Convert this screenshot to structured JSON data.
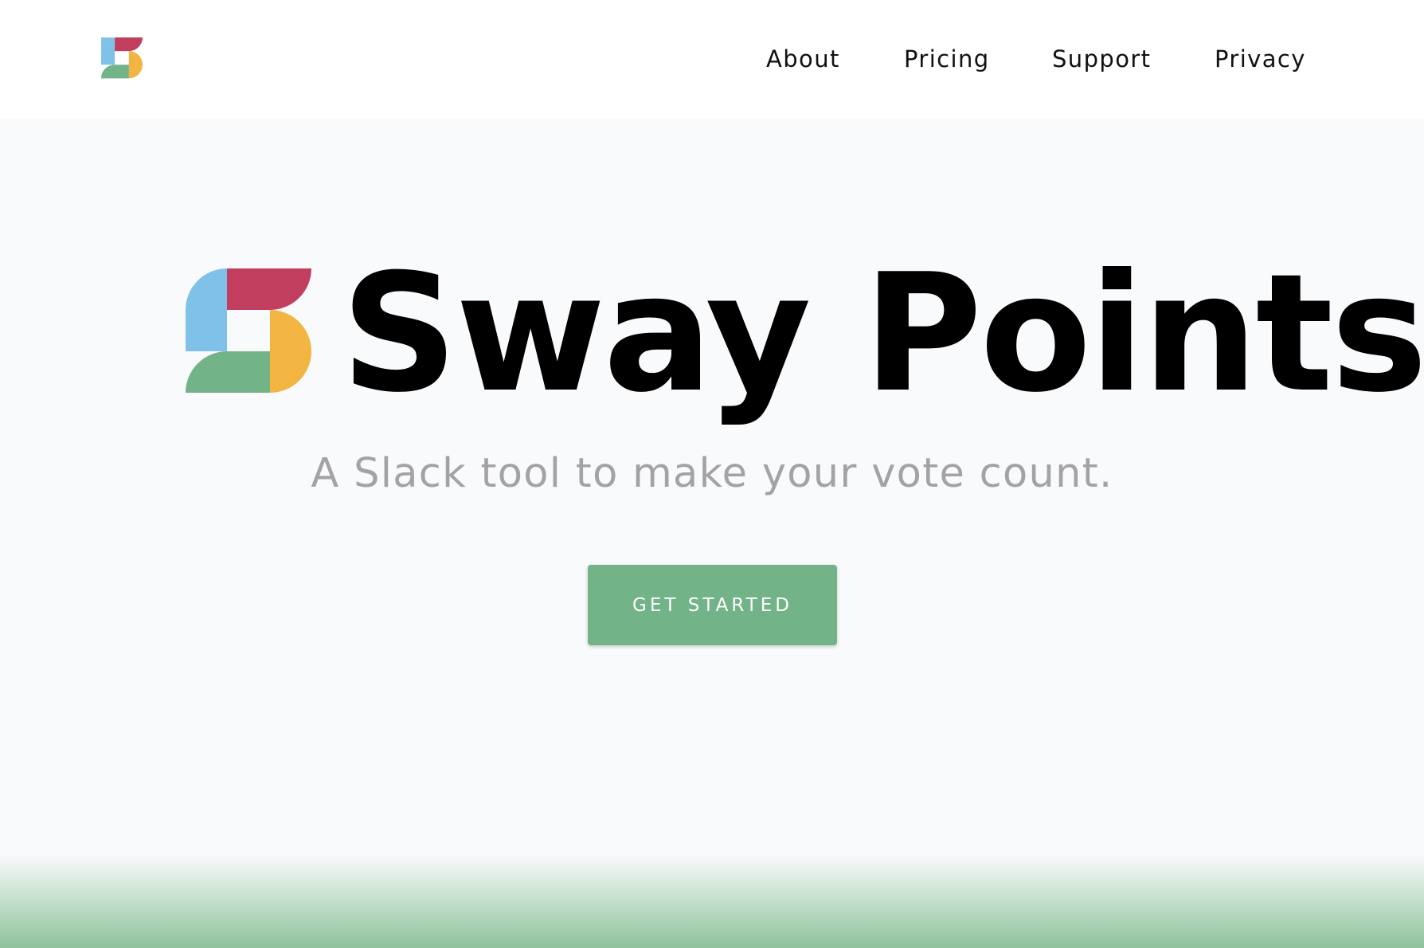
{
  "header": {
    "brand_logo": "sway-points-logo",
    "nav": [
      {
        "label": "About"
      },
      {
        "label": "Pricing"
      },
      {
        "label": "Support"
      },
      {
        "label": "Privacy"
      }
    ]
  },
  "hero": {
    "logo": "sway-points-logo",
    "title": "Sway Points",
    "subtitle": "A Slack tool to make your vote count.",
    "cta_label": "GET STARTED"
  },
  "colors": {
    "logo_blue": "#7fc1e8",
    "logo_red": "#c13e5e",
    "logo_yellow": "#f3b541",
    "logo_green": "#72b388",
    "cta_background": "#72b388",
    "page_background": "#f9fafc",
    "subtitle_text": "#a3a3a6"
  }
}
